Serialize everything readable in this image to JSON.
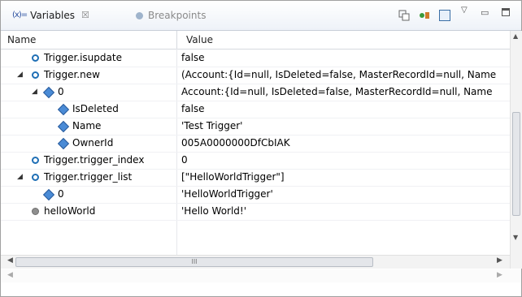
{
  "tabs": {
    "variables": {
      "label": "Variables",
      "icon": "(x)="
    },
    "breakpoints": {
      "label": "Breakpoints"
    }
  },
  "table": {
    "columns": {
      "name": "Name",
      "value": "Value"
    },
    "rows": [
      {
        "name": "Trigger.isupdate",
        "value": "false",
        "icon": "circle",
        "twisty": ""
      },
      {
        "name": "Trigger.new",
        "value": "(Account:{Id=null, IsDeleted=false, MasterRecordId=null, Name",
        "icon": "circle",
        "twisty": "expanded"
      },
      {
        "name": "0",
        "value": "Account:{Id=null, IsDeleted=false, MasterRecordId=null, Name",
        "icon": "diamond",
        "twisty": "expanded"
      },
      {
        "name": "IsDeleted",
        "value": "false",
        "icon": "diamond",
        "twisty": ""
      },
      {
        "name": "Name",
        "value": "'Test Trigger'",
        "icon": "diamond",
        "twisty": ""
      },
      {
        "name": "OwnerId",
        "value": "005A0000000DfCbIAK",
        "icon": "diamond",
        "twisty": ""
      },
      {
        "name": "Trigger.trigger_index",
        "value": "0",
        "icon": "circle",
        "twisty": ""
      },
      {
        "name": "Trigger.trigger_list",
        "value": "[\"HelloWorldTrigger\"]",
        "icon": "circle",
        "twisty": "expanded"
      },
      {
        "name": "0",
        "value": "'HelloWorldTrigger'",
        "icon": "diamond",
        "twisty": ""
      },
      {
        "name": "helloWorld",
        "value": "'Hello World!'",
        "icon": "gray-circle",
        "twisty": ""
      }
    ]
  },
  "scrollbar": {
    "grip": "III"
  }
}
